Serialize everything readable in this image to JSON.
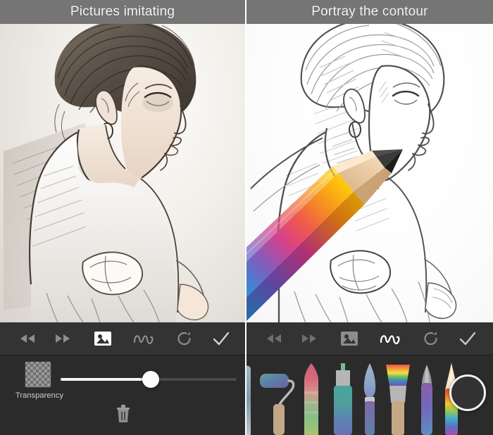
{
  "panels": [
    {
      "id": "left",
      "header": {
        "title": "Pictures imitating"
      },
      "artwork": {
        "name": "sepia-sketch-portrait-woman-profile",
        "style": "shaded sepia pencil sketch"
      },
      "toolbar": {
        "items": [
          {
            "name": "rewind-icon",
            "label": "Rewind",
            "active": false
          },
          {
            "name": "fast-forward-icon",
            "label": "Fast forward",
            "active": false
          },
          {
            "name": "image-layer-icon",
            "label": "Image layer",
            "active": true
          },
          {
            "name": "sketch-stroke-icon",
            "label": "Sketch layer",
            "active": false
          },
          {
            "name": "redo-icon",
            "label": "Redo",
            "active": false
          },
          {
            "name": "confirm-check-icon",
            "label": "Confirm",
            "active": false
          }
        ]
      },
      "controls": {
        "transparency_label": "Transparency",
        "transparency_value": 51,
        "delete_label": "Delete"
      }
    },
    {
      "id": "right",
      "header": {
        "title": "Portray the contour"
      },
      "artwork": {
        "name": "line-art-contour-portrait-woman-profile",
        "style": "clean contour line drawing"
      },
      "overlay": {
        "name": "rainbow-pencil-graphic",
        "label": "Rainbow pencil"
      },
      "toolbar": {
        "items": [
          {
            "name": "rewind-icon",
            "label": "Rewind",
            "active": false
          },
          {
            "name": "fast-forward-icon",
            "label": "Fast forward",
            "active": false
          },
          {
            "name": "image-layer-icon",
            "label": "Image layer",
            "active": false
          },
          {
            "name": "sketch-stroke-icon",
            "label": "Sketch layer",
            "active": true
          },
          {
            "name": "redo-icon",
            "label": "Redo",
            "active": false
          },
          {
            "name": "confirm-check-icon",
            "label": "Confirm",
            "active": false
          }
        ]
      },
      "brushes": [
        {
          "name": "brush-tool-partial",
          "label": "Airbrush"
        },
        {
          "name": "paint-roller-tool",
          "label": "Paint roller"
        },
        {
          "name": "crayon-tool",
          "label": "Crayon"
        },
        {
          "name": "highlighter-tool",
          "label": "Highlighter"
        },
        {
          "name": "round-brush-tool",
          "label": "Round brush"
        },
        {
          "name": "flat-brush-tool",
          "label": "Flat brush"
        },
        {
          "name": "pen-tool",
          "label": "Pen"
        },
        {
          "name": "colored-pencil-tool",
          "label": "Colored pencil"
        }
      ],
      "color_swatch": {
        "name": "color-swatch",
        "label": "Current colour",
        "color": "#323233"
      }
    }
  ],
  "colors": {
    "header_bg": "#757575",
    "toolbar_bg": "#333334",
    "panel_bg": "#2b2b2b",
    "accent_white": "#f4f4f4",
    "icon_inactive": "#8d8d8d",
    "icon_active": "#ffffff"
  }
}
